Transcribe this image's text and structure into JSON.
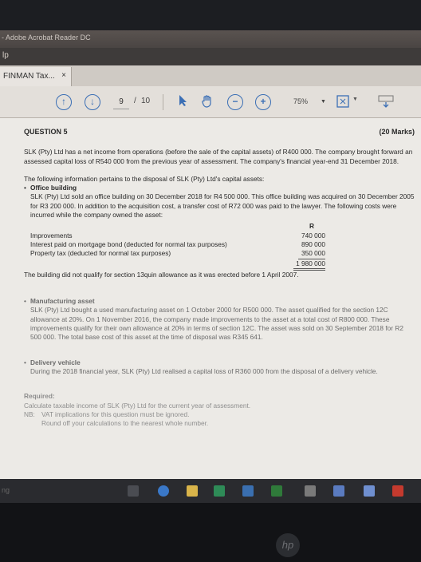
{
  "window": {
    "title": "- Adobe Acrobat Reader DC",
    "menu": "lp"
  },
  "tab": {
    "label": "FINMAN Tax...",
    "close": "×"
  },
  "toolbar": {
    "page_current": "9",
    "page_sep": "/",
    "page_total": "10",
    "zoom": "75%"
  },
  "doc": {
    "question": "QUESTION 5",
    "marks": "(20 Marks)",
    "intro": "SLK (Pty) Ltd has a net income from operations (before the sale of the capital assets) of R400 000. The company brought forward an assessed capital loss of R540 000 from the previous year of assessment. The company's financial year-end 31 December 2018.",
    "info": "The following information pertains to the disposal of SLK (Pty) Ltd's capital assets:",
    "office": {
      "title": "Office building",
      "text": "SLK (Pty) Ltd sold an office building on 30 December 2018 for R4 500 000. This office building was acquired on 30 December 2005 for R3 200 000. In addition to the acquisition cost, a transfer cost of R72 000 was paid to the lawyer. The following costs were incurred while the company owned the asset:",
      "currency": "R",
      "rows": [
        {
          "label": "Improvements",
          "value": "740 000"
        },
        {
          "label": "Interest paid on mortgage bond (deducted for normal tax purposes)",
          "value": "890 000"
        },
        {
          "label": "Property tax (deducted for normal tax purposes)",
          "value": "350 000"
        }
      ],
      "total": "1 980 000",
      "note": "The building did not qualify for section 13quin allowance as it was erected before 1 April 2007."
    },
    "manufacturing": {
      "title": "Manufacturing asset",
      "text": "SLK (Pty) Ltd bought a used manufacturing asset on 1 October 2000 for R500 000. The asset qualified for the section 12C allowance at 20%. On 1 November 2016, the company made improvements to the asset at a total cost of R800 000. These improvements qualify for their own allowance at 20% in terms of section 12C. The asset was sold on 30 September 2018 for R2 500 000. The total base cost of this asset at the time of disposal was R345 641."
    },
    "delivery": {
      "title": "Delivery vehicle",
      "text": "During the 2018 financial year, SLK (Pty) Ltd realised a capital loss of R360 000 from the disposal of a delivery vehicle."
    },
    "required": {
      "title": "Required:",
      "line1": "Calculate taxable income of SLK (Pty) Ltd for the current year of assessment.",
      "nb": "NB:",
      "line2": "VAT implications for this question must be ignored.",
      "line3": "Round off your calculations to the nearest whole number."
    }
  },
  "taskbar": {
    "left_text": "ng"
  },
  "colors": {
    "accent": "#3b6fb5",
    "page": "#eceae6",
    "titlebar": "#4e4846"
  }
}
